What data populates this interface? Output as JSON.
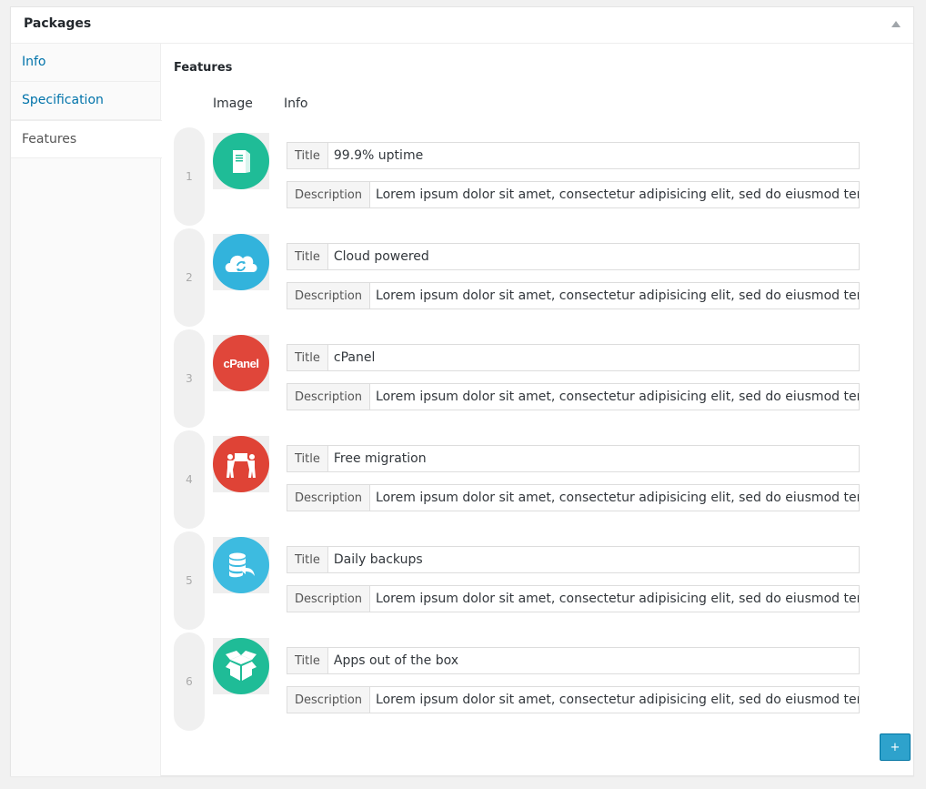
{
  "box": {
    "title": "Packages"
  },
  "tabs": [
    {
      "label": "Info"
    },
    {
      "label": "Specification"
    },
    {
      "label": "Features"
    }
  ],
  "panel": {
    "heading": "Features",
    "columns": {
      "image": "Image",
      "info": "Info"
    },
    "title_label": "Title",
    "description_label": "Description",
    "add_label": "+"
  },
  "features": [
    {
      "num": "1",
      "title": "99.9% uptime",
      "description": "Lorem ipsum dolor sit amet, consectetur adipisicing elit, sed do eiusmod tempor",
      "icon": "server-icon",
      "color": "#1fbc97"
    },
    {
      "num": "2",
      "title": "Cloud powered",
      "description": "Lorem ipsum dolor sit amet, consectetur adipisicing elit, sed do eiusmod tempor",
      "icon": "cloud-sync-icon",
      "color": "#32b3dc"
    },
    {
      "num": "3",
      "title": "cPanel",
      "description": "Lorem ipsum dolor sit amet, consectetur adipisicing elit, sed do eiusmod tempor",
      "icon": "cpanel-logo-icon",
      "color": "#e0463a",
      "logo_text": "cPanel"
    },
    {
      "num": "4",
      "title": "Free migration",
      "description": "Lorem ipsum dolor sit amet, consectetur adipisicing elit, sed do eiusmod tempor",
      "icon": "movers-icon",
      "color": "#df4336"
    },
    {
      "num": "5",
      "title": "Daily backups",
      "description": "Lorem ipsum dolor sit amet, consectetur adipisicing elit, sed do eiusmod tempor",
      "icon": "database-backup-icon",
      "color": "#3dbbe0"
    },
    {
      "num": "6",
      "title": "Apps out of the box",
      "description": "Lorem ipsum dolor sit amet, consectetur adipisicing elit, sed do eiusmod tempor",
      "icon": "open-box-icon",
      "color": "#1fbc97"
    }
  ]
}
